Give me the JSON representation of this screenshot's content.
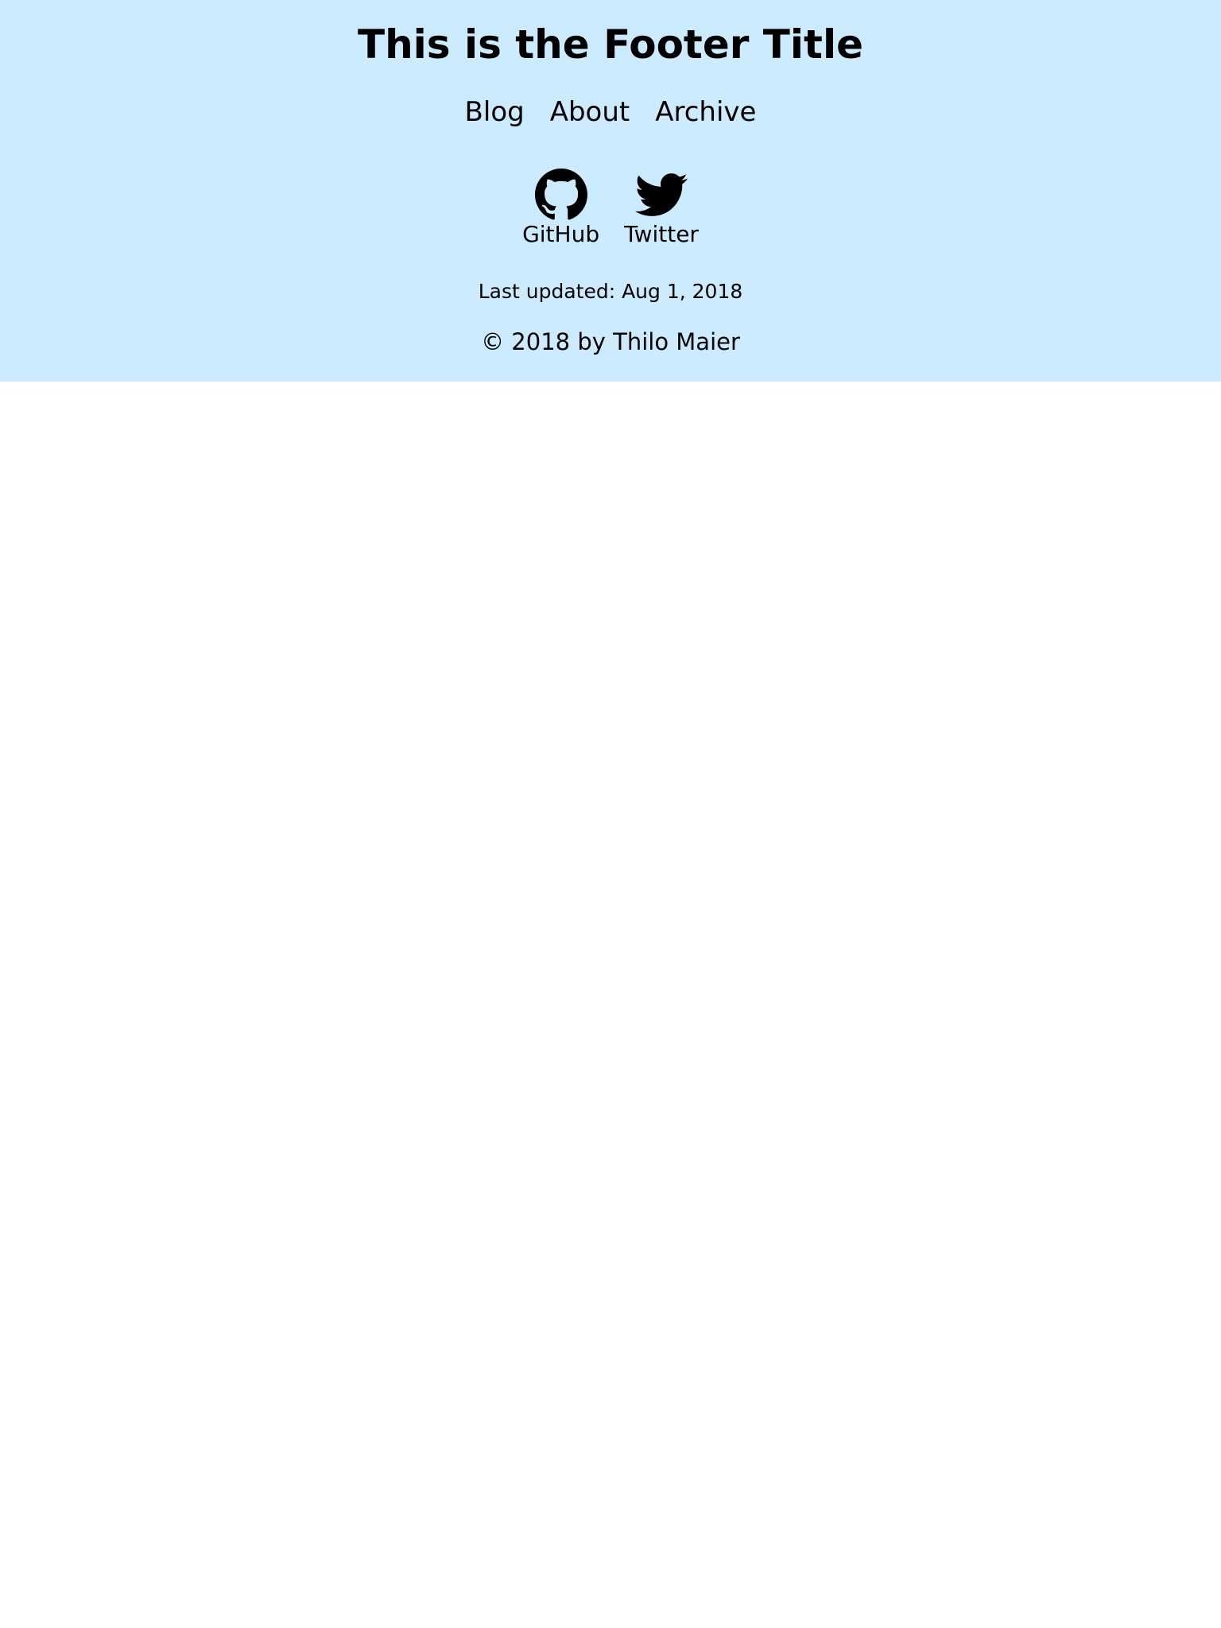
{
  "footer": {
    "title": "This is the Footer Title",
    "background_color": "#cdebff",
    "nav": [
      {
        "label": "Blog"
      },
      {
        "label": "About"
      },
      {
        "label": "Archive"
      }
    ],
    "social": [
      {
        "label": "GitHub",
        "icon": "github-icon"
      },
      {
        "label": "Twitter",
        "icon": "twitter-icon"
      }
    ],
    "last_updated": "Last updated: Aug 1, 2018",
    "copyright": "© 2018 by Thilo Maier"
  }
}
